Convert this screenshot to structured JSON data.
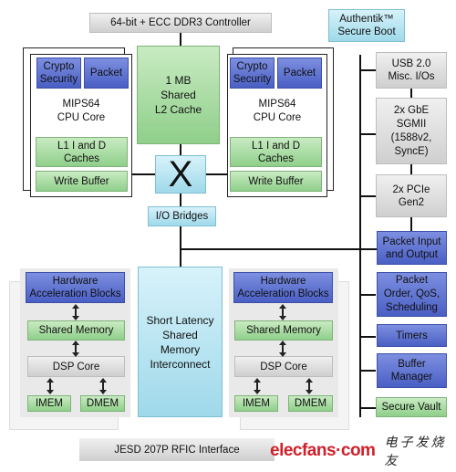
{
  "ddr_controller": "64-bit + ECC DDR3 Controller",
  "secure_boot": "Authentik™\nSecure Boot",
  "cpu_left": {
    "crypto": "Crypto\nSecurity",
    "packet": "Packet",
    "core": "MIPS64\nCPU Core",
    "l1": "L1 I and D\nCaches",
    "write_buffer": "Write Buffer"
  },
  "cpu_right": {
    "crypto": "Crypto\nSecurity",
    "packet": "Packet",
    "core": "MIPS64\nCPU Core",
    "l1": "L1 I and D\nCaches",
    "write_buffer": "Write Buffer"
  },
  "l2_cache": "1 MB\nShared\nL2 Cache",
  "crossbar": "X",
  "io_bridges": "I/O Bridges",
  "peripherals": [
    {
      "label": "USB 2.0\nMisc. I/Os"
    },
    {
      "label": "2x GbE\nSGMII\n(1588v2,\nSyncE)"
    },
    {
      "label": "2x PCIe\nGen2"
    },
    {
      "label": "Packet Input\nand Output"
    },
    {
      "label": "Packet\nOrder, QoS,\nScheduling"
    },
    {
      "label": "Timers"
    },
    {
      "label": "Buffer\nManager"
    },
    {
      "label": "Secure Vault"
    }
  ],
  "dsp_left": {
    "hw_accel": "Hardware\nAcceleration Blocks",
    "shared_mem": "Shared Memory",
    "dsp_core": "DSP Core",
    "imem": "IMEM",
    "dmem": "DMEM"
  },
  "dsp_right": {
    "hw_accel": "Hardware\nAcceleration Blocks",
    "shared_mem": "Shared Memory",
    "dsp_core": "DSP Core",
    "imem": "IMEM",
    "dmem": "DMEM"
  },
  "interconnect": "Short Latency\nShared\nMemory\nInterconnect",
  "rfic": "JESD 207P RFIC Interface",
  "watermark": {
    "brand": "elecfans·com",
    "cn": "电子发烧友"
  },
  "colors": {
    "blue": "#5a6fd0",
    "green": "#a8dca2",
    "gray": "#dcdcdc",
    "light_blue": "#b8e4f0",
    "watermark": "#d0202a"
  }
}
